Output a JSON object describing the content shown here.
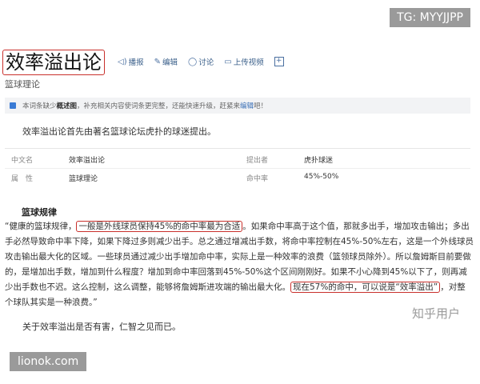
{
  "watermark_top": "TG: MYYJJPP",
  "watermark_bottom": "lionok.com",
  "watermark_zhihu": "知乎用户",
  "header": {
    "title": "效率溢出论",
    "subtitle": "篮球理论",
    "actions": [
      {
        "icon": "speaker-icon",
        "label": "播报"
      },
      {
        "icon": "edit-icon",
        "label": "编辑"
      },
      {
        "icon": "chat-icon",
        "label": "讨论"
      },
      {
        "icon": "video-icon",
        "label": "上传视频"
      },
      {
        "icon": "plus-icon",
        "label": "+"
      }
    ]
  },
  "notice": {
    "prefix": "本词条缺少",
    "bold": "概述图",
    "middle": "，补充相关内容使词条更完整，还能快速升级，赶紧来",
    "link": "编辑",
    "suffix": "吧！"
  },
  "intro": "效率溢出论首先由著名篮球论坛虎扑的球迷提出。",
  "infobox": {
    "rows": [
      {
        "k1": "中文名",
        "v1": "效率溢出论",
        "k2": "提出者",
        "v2": "虎扑球迷"
      },
      {
        "k1": "属　性",
        "v1": "篮球理论",
        "k2": "命中率",
        "v2": "45%-50%"
      }
    ]
  },
  "section_title": "篮球规律",
  "body": {
    "p1_pre": "“健康的篮球规律，",
    "p1_hl": "一般是外线球员保持45%的命中率最为合适",
    "p1_mid": "。如果命中率高于这个值，那就多出手，增加攻击输出；多出手必然导致命中率下降，如果下降过多则减少出手。总之通过增减出手数，将命中率控制在45%-50%左右，这是一个外线球员攻击输出最大化的区域。一些球员通过减少出手增加命中率，实际上是一种效率的浪费（篮领球员除外）。所以詹姆斯目前要做的，是增加出手数，增加到什么程度？增加到命中率回落到45%-50%这个区间刚刚好。如果不小心降到45%以下了，则再减少出手数也不迟。这么控制，这么调整，能够将詹姆斯进攻端的输出最大化。",
    "p1_hl2": "现在57%的命中，可以说是“效率溢出”",
    "p1_end": "，对整个球队其实是一种浪费。”"
  },
  "closing": "关于效率溢出是否有害，仁智之见而已。"
}
